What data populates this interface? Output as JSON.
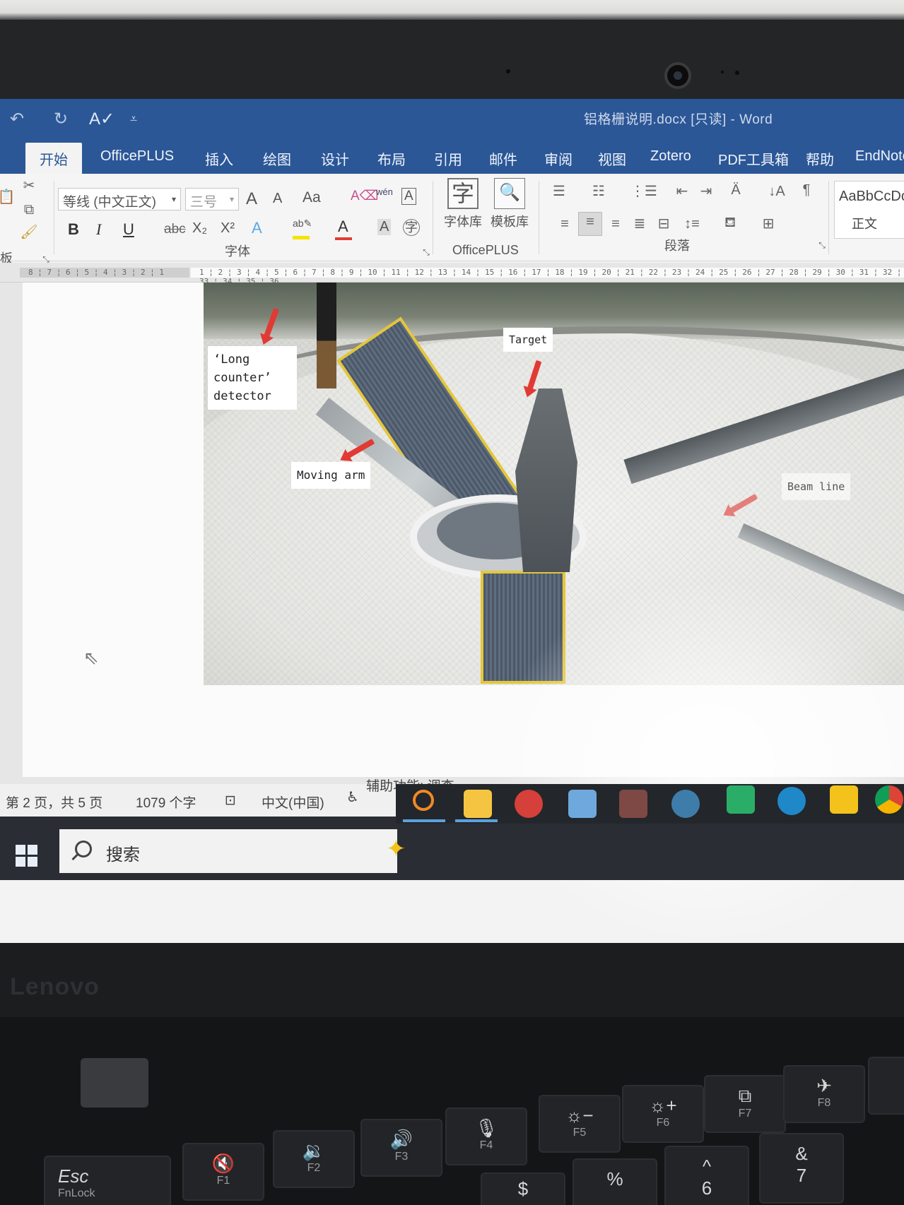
{
  "window": {
    "title": "铝格栅说明.docx [只读] - Word",
    "quick_access": [
      "undo",
      "redo",
      "spelling",
      "customize"
    ]
  },
  "ribbon_tabs": [
    {
      "label": "开始",
      "active": true
    },
    {
      "label": "OfficePLUS"
    },
    {
      "label": "插入"
    },
    {
      "label": "绘图"
    },
    {
      "label": "设计"
    },
    {
      "label": "布局"
    },
    {
      "label": "引用"
    },
    {
      "label": "邮件"
    },
    {
      "label": "审阅"
    },
    {
      "label": "视图"
    },
    {
      "label": "Zotero"
    },
    {
      "label": "PDF工具箱"
    },
    {
      "label": "帮助"
    },
    {
      "label": "EndNote"
    }
  ],
  "ribbon": {
    "clipboard_label": "板",
    "font_name": "等线 (中文正文)",
    "font_size": "三号",
    "font_group_label": "字体",
    "bold": "B",
    "italic": "I",
    "underline": "U",
    "strikethrough": "abc",
    "subscript": "X₂",
    "superscript": "X²",
    "grow_font": "A",
    "shrink_font": "A",
    "change_case": "Aa",
    "phonetic": "wén",
    "char_border": "A",
    "officeplus_font_lib": "字体库",
    "officeplus_template_lib": "模板库",
    "officeplus_glyph": "字",
    "officeplus_group_label": "OfficePLUS",
    "paragraph_group_label": "段落",
    "style_preview": "AaBbCcDc",
    "style_name": "正文"
  },
  "document": {
    "labels": {
      "long_counter": [
        "‘Long",
        "counter’",
        "detector"
      ],
      "target": "Target",
      "moving_arm": "Moving arm",
      "beam_line": "Beam line"
    }
  },
  "status": {
    "page": "第 2 页，共 5 页",
    "words": "1079 个字",
    "language": "中文(中国)",
    "accessibility": "辅助功能: 调查"
  },
  "taskbar": {
    "search_placeholder": "搜索",
    "apps": [
      "search-app",
      "file-explorer",
      "snipping-tool",
      "app-4",
      "app-5",
      "app-6",
      "wechat",
      "edge-dev",
      "sticky-notes",
      "chrome"
    ]
  },
  "device": {
    "brand": "Lenovo"
  },
  "keyboard": {
    "keys": [
      {
        "main": "Esc",
        "sub": "FnLock"
      },
      {
        "main": "🔇",
        "sub": "F1"
      },
      {
        "main": "🔉",
        "sub": "F2"
      },
      {
        "main": "🔊",
        "sub": "F3"
      },
      {
        "main": "🎙",
        "sub": "F4"
      },
      {
        "main": "☼−",
        "sub": "F5"
      },
      {
        "main": "☼+",
        "sub": "F6"
      },
      {
        "main": "⧉",
        "sub": "F7"
      },
      {
        "main": "✈",
        "sub": "F8"
      }
    ],
    "number_keys": [
      "$",
      "%",
      "^",
      "&"
    ],
    "number_subs": [
      "",
      "",
      "6",
      "7"
    ]
  },
  "colors": {
    "word_blue": "#2b5797",
    "arrow_red": "#e13a34",
    "walkway_yellow": "#e4c63a"
  }
}
